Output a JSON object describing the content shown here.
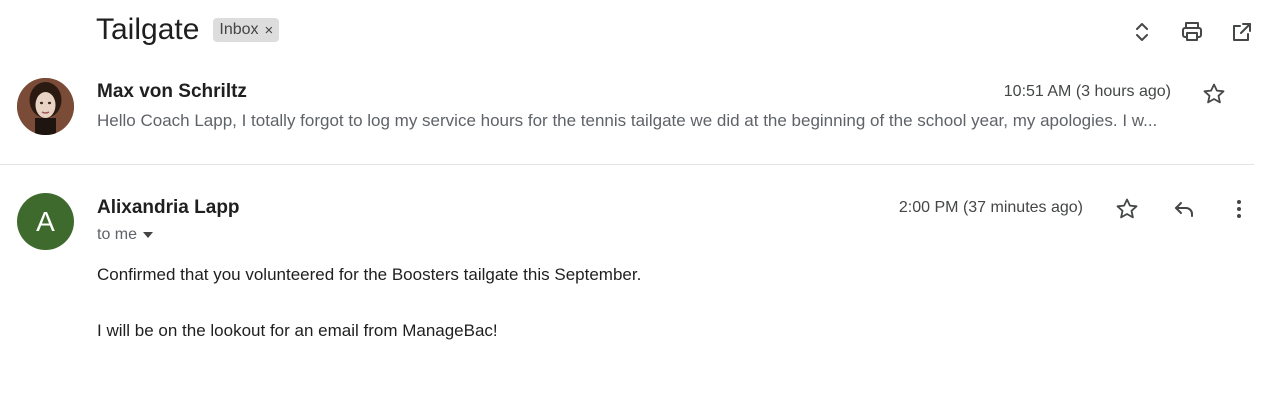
{
  "thread": {
    "subject": "Tailgate",
    "label": "Inbox",
    "label_remove": "×",
    "actions": [
      "expand-collapse-icon",
      "print-icon",
      "open-in-new-window-icon"
    ]
  },
  "messages": [
    {
      "sender": "Max von Schriltz",
      "time": "10:51 AM (3 hours ago)",
      "snippet": "Hello Coach Lapp, I totally forgot to log my service hours for the tennis tailgate we did at the beginning of the school year, my apologies. I w...",
      "avatar": "profile-photo"
    },
    {
      "sender": "Alixandria Lapp",
      "avatar_letter": "A",
      "avatar_color": "#3e6b2d",
      "recipient": "to me",
      "time": "2:00 PM (37 minutes ago)",
      "body": [
        "Confirmed that you volunteered for the Boosters tailgate this September.",
        "I will be on the lookout for an email from ManageBac!"
      ]
    }
  ]
}
